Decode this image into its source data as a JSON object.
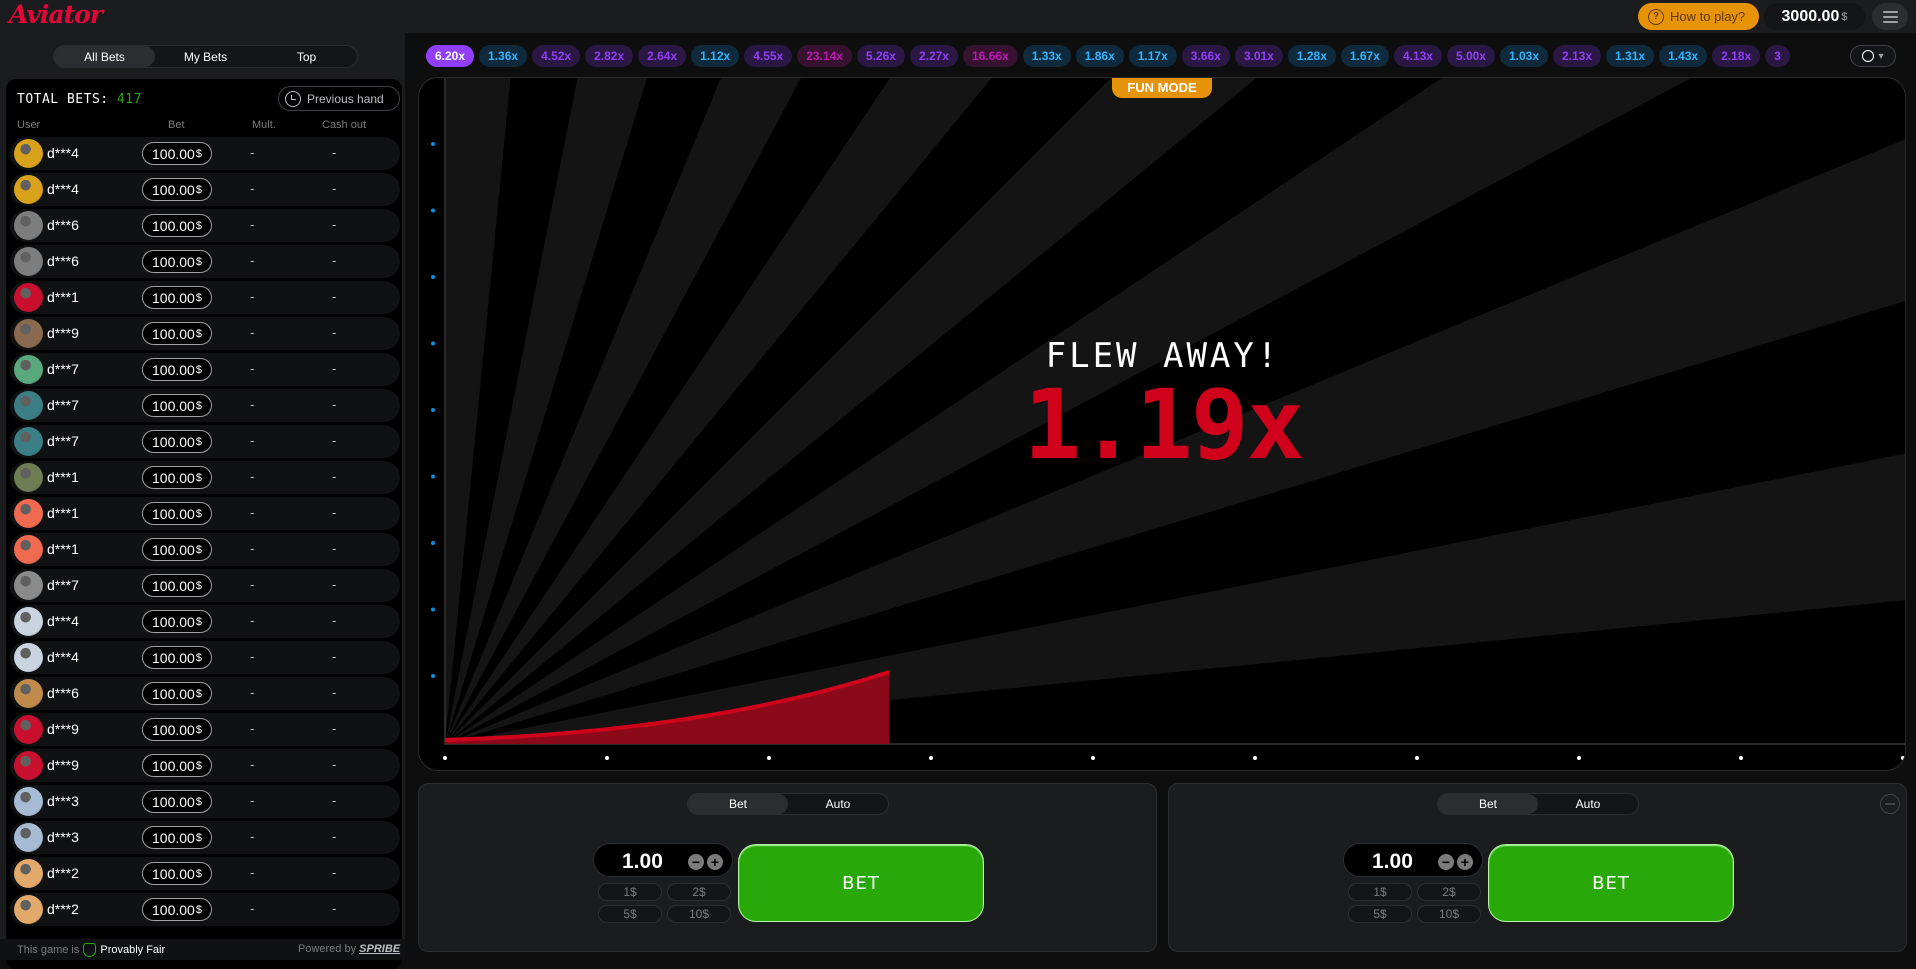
{
  "header": {
    "logo": "Aviator",
    "how_to_play": "How to play?",
    "balance": "3000.00",
    "balance_currency": "$"
  },
  "bets_tabs": [
    "All Bets",
    "My Bets",
    "Top"
  ],
  "bets_panel": {
    "total_label": "TOTAL BETS:",
    "total_count": "417",
    "previous_hand": "Previous hand",
    "columns": [
      "User",
      "Bet",
      "Mult.",
      "Cash out"
    ],
    "rows": [
      {
        "user": "d***4",
        "bet": "100.00",
        "cur": "$",
        "mult": "-",
        "cash": "-",
        "avatar_color": "#d9a21b"
      },
      {
        "user": "d***4",
        "bet": "100.00",
        "cur": "$",
        "mult": "-",
        "cash": "-",
        "avatar_color": "#d9a21b"
      },
      {
        "user": "d***6",
        "bet": "100.00",
        "cur": "$",
        "mult": "-",
        "cash": "-",
        "avatar_color": "#7d7d7d"
      },
      {
        "user": "d***6",
        "bet": "100.00",
        "cur": "$",
        "mult": "-",
        "cash": "-",
        "avatar_color": "#7d7d7d"
      },
      {
        "user": "d***1",
        "bet": "100.00",
        "cur": "$",
        "mult": "-",
        "cash": "-",
        "avatar_color": "#c8102e"
      },
      {
        "user": "d***9",
        "bet": "100.00",
        "cur": "$",
        "mult": "-",
        "cash": "-",
        "avatar_color": "#8a6a4f"
      },
      {
        "user": "d***7",
        "bet": "100.00",
        "cur": "$",
        "mult": "-",
        "cash": "-",
        "avatar_color": "#5aa87e"
      },
      {
        "user": "d***7",
        "bet": "100.00",
        "cur": "$",
        "mult": "-",
        "cash": "-",
        "avatar_color": "#3c7e86"
      },
      {
        "user": "d***7",
        "bet": "100.00",
        "cur": "$",
        "mult": "-",
        "cash": "-",
        "avatar_color": "#3c7e86"
      },
      {
        "user": "d***1",
        "bet": "100.00",
        "cur": "$",
        "mult": "-",
        "cash": "-",
        "avatar_color": "#6f7d55"
      },
      {
        "user": "d***1",
        "bet": "100.00",
        "cur": "$",
        "mult": "-",
        "cash": "-",
        "avatar_color": "#f06a50"
      },
      {
        "user": "d***1",
        "bet": "100.00",
        "cur": "$",
        "mult": "-",
        "cash": "-",
        "avatar_color": "#f06a50"
      },
      {
        "user": "d***7",
        "bet": "100.00",
        "cur": "$",
        "mult": "-",
        "cash": "-",
        "avatar_color": "#8a8a8a"
      },
      {
        "user": "d***4",
        "bet": "100.00",
        "cur": "$",
        "mult": "-",
        "cash": "-",
        "avatar_color": "#c9d4e0"
      },
      {
        "user": "d***4",
        "bet": "100.00",
        "cur": "$",
        "mult": "-",
        "cash": "-",
        "avatar_color": "#c9d4e0"
      },
      {
        "user": "d***6",
        "bet": "100.00",
        "cur": "$",
        "mult": "-",
        "cash": "-",
        "avatar_color": "#c08b4a"
      },
      {
        "user": "d***9",
        "bet": "100.00",
        "cur": "$",
        "mult": "-",
        "cash": "-",
        "avatar_color": "#c8102e"
      },
      {
        "user": "d***9",
        "bet": "100.00",
        "cur": "$",
        "mult": "-",
        "cash": "-",
        "avatar_color": "#c8102e"
      },
      {
        "user": "d***3",
        "bet": "100.00",
        "cur": "$",
        "mult": "-",
        "cash": "-",
        "avatar_color": "#a7bcd4"
      },
      {
        "user": "d***3",
        "bet": "100.00",
        "cur": "$",
        "mult": "-",
        "cash": "-",
        "avatar_color": "#a7bcd4"
      },
      {
        "user": "d***2",
        "bet": "100.00",
        "cur": "$",
        "mult": "-",
        "cash": "-",
        "avatar_color": "#e3a96b"
      },
      {
        "user": "d***2",
        "bet": "100.00",
        "cur": "$",
        "mult": "-",
        "cash": "-",
        "avatar_color": "#e3a96b"
      }
    ],
    "footer_this_game": "This game is",
    "footer_provably_fair": "Provably Fair",
    "footer_powered_by": "Powered by",
    "footer_brand": "SPRIBE"
  },
  "history": [
    {
      "v": "6.20x",
      "c": "purple"
    },
    {
      "v": "1.36x",
      "c": "blue"
    },
    {
      "v": "4.52x",
      "c": "purple"
    },
    {
      "v": "2.82x",
      "c": "purple"
    },
    {
      "v": "2.64x",
      "c": "purple"
    },
    {
      "v": "1.12x",
      "c": "blue"
    },
    {
      "v": "4.55x",
      "c": "purple"
    },
    {
      "v": "23.14x",
      "c": "pink"
    },
    {
      "v": "5.26x",
      "c": "purple"
    },
    {
      "v": "2.27x",
      "c": "purple"
    },
    {
      "v": "16.66x",
      "c": "pink"
    },
    {
      "v": "1.33x",
      "c": "blue"
    },
    {
      "v": "1.86x",
      "c": "blue"
    },
    {
      "v": "1.17x",
      "c": "blue"
    },
    {
      "v": "3.66x",
      "c": "purple"
    },
    {
      "v": "3.01x",
      "c": "purple"
    },
    {
      "v": "1.28x",
      "c": "blue"
    },
    {
      "v": "1.67x",
      "c": "blue"
    },
    {
      "v": "4.13x",
      "c": "purple"
    },
    {
      "v": "5.00x",
      "c": "purple"
    },
    {
      "v": "1.03x",
      "c": "blue"
    },
    {
      "v": "2.13x",
      "c": "purple"
    },
    {
      "v": "1.31x",
      "c": "blue"
    },
    {
      "v": "1.43x",
      "c": "blue"
    },
    {
      "v": "2.18x",
      "c": "purple"
    },
    {
      "v": "3",
      "c": "purple"
    }
  ],
  "game": {
    "fun_mode": "FUN MODE",
    "flew_away": "FLEW AWAY!",
    "multiplier": "1.19x",
    "accent_color": "#d0021b"
  },
  "bet_panels": [
    {
      "tabs": [
        "Bet",
        "Auto"
      ],
      "amount": "1.00",
      "quick": [
        "1$",
        "2$",
        "5$",
        "10$"
      ],
      "button": "BET"
    },
    {
      "tabs": [
        "Bet",
        "Auto"
      ],
      "amount": "1.00",
      "quick": [
        "1$",
        "2$",
        "5$",
        "10$"
      ],
      "button": "BET"
    }
  ]
}
